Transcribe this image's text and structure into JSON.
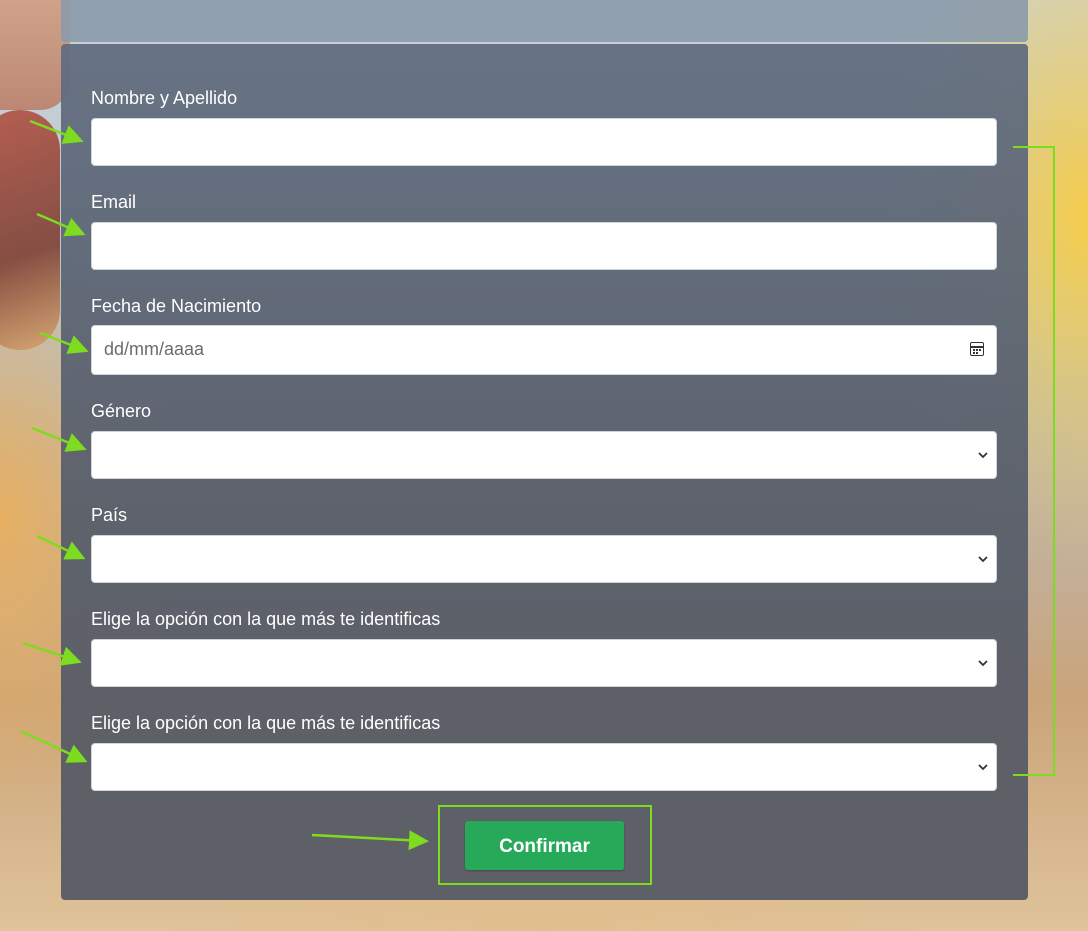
{
  "form": {
    "fields": [
      {
        "label": "Nombre y Apellido",
        "type": "text",
        "value": ""
      },
      {
        "label": "Email",
        "type": "email",
        "value": ""
      },
      {
        "label": "Fecha de Nacimiento",
        "type": "date",
        "placeholder": "dd/mm/aaaa",
        "icon": "calendar-icon"
      },
      {
        "label": "Género",
        "type": "select",
        "value": ""
      },
      {
        "label": "País",
        "type": "select",
        "value": ""
      },
      {
        "label": "Elige la opción con la que más te identificas",
        "type": "select",
        "value": ""
      },
      {
        "label": "Elige la opción con la que más te identificas",
        "type": "select",
        "value": ""
      }
    ],
    "submit_label": "Confirmar"
  },
  "annotation": {
    "arrow_color": "#7ddc1f",
    "button_color": "#27a95a"
  }
}
